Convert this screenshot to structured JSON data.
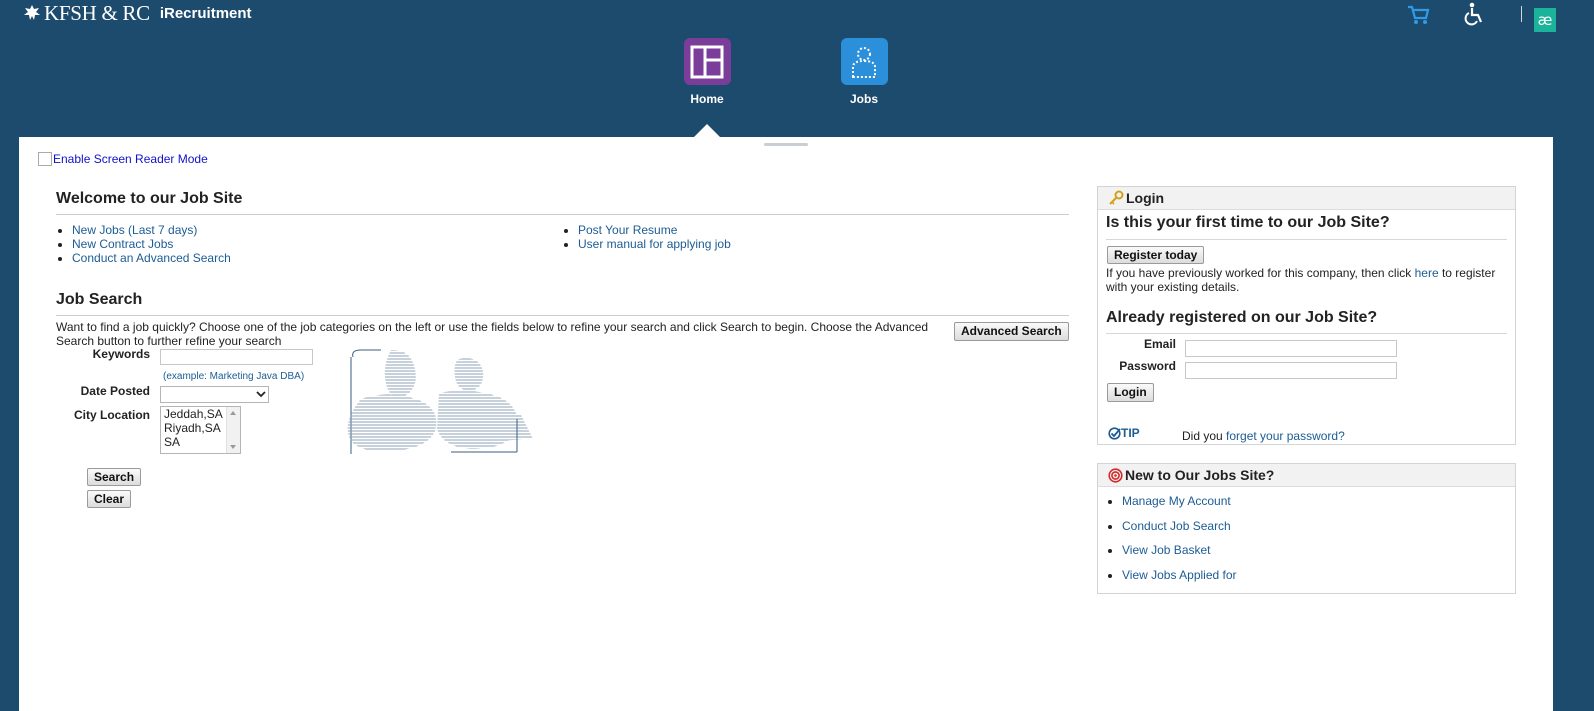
{
  "header": {
    "logo_text": "KFSH & RC",
    "app_title": "iRecruitment",
    "avatar_initials": "æ",
    "nav": [
      {
        "label": "Home",
        "icon": "dashboard-icon",
        "color": "#7a3d99"
      },
      {
        "label": "Jobs",
        "icon": "person-icon",
        "color": "#2b8fd9"
      }
    ]
  },
  "reader_mode_link": "Enable Screen Reader Mode",
  "welcome": {
    "title": "Welcome to our Job Site",
    "links_left": [
      "New Jobs (Last 7 days)",
      "New Contract Jobs",
      "Conduct an Advanced Search"
    ],
    "links_right": [
      "Post Your Resume",
      "User manual for applying job"
    ]
  },
  "job_search": {
    "title": "Job Search",
    "description": "Want to find a job quickly? Choose one of the job categories on the left or use the fields below to refine your search and click Search to begin. Choose the Advanced Search button to further refine your search",
    "advanced_button": "Advanced Search",
    "keywords_label": "Keywords",
    "keywords_value": "",
    "keywords_hint": "(example: Marketing Java DBA)",
    "date_posted_label": "Date Posted",
    "date_posted_value": "",
    "city_label": "City Location",
    "city_options": [
      "Jeddah,SA",
      "Riyadh,SA",
      "SA"
    ],
    "search_button": "Search",
    "clear_button": "Clear"
  },
  "login_panel": {
    "header": "Login",
    "first_time_title": "Is this your first time to our Job Site?",
    "register_button": "Register today",
    "previous_text_before": "If you have previously worked for this company, then click ",
    "previous_link": "here",
    "previous_text_after": " to register with your existing details.",
    "registered_title": "Already registered on our Job Site?",
    "email_label": "Email",
    "email_value": "",
    "password_label": "Password",
    "password_value": "",
    "login_button": "Login",
    "tip_label": "TIP",
    "tip_text": "Did you ",
    "tip_link": "forget your password?"
  },
  "new_panel": {
    "header": "New to Our Jobs Site?",
    "links": [
      "Manage My Account",
      "Conduct Job Search",
      "View Job Basket",
      "View Jobs Applied for"
    ]
  },
  "colors": {
    "header_bg": "#1d4b6e",
    "link": "#1c5c94",
    "avatar": "#1bb39a"
  }
}
